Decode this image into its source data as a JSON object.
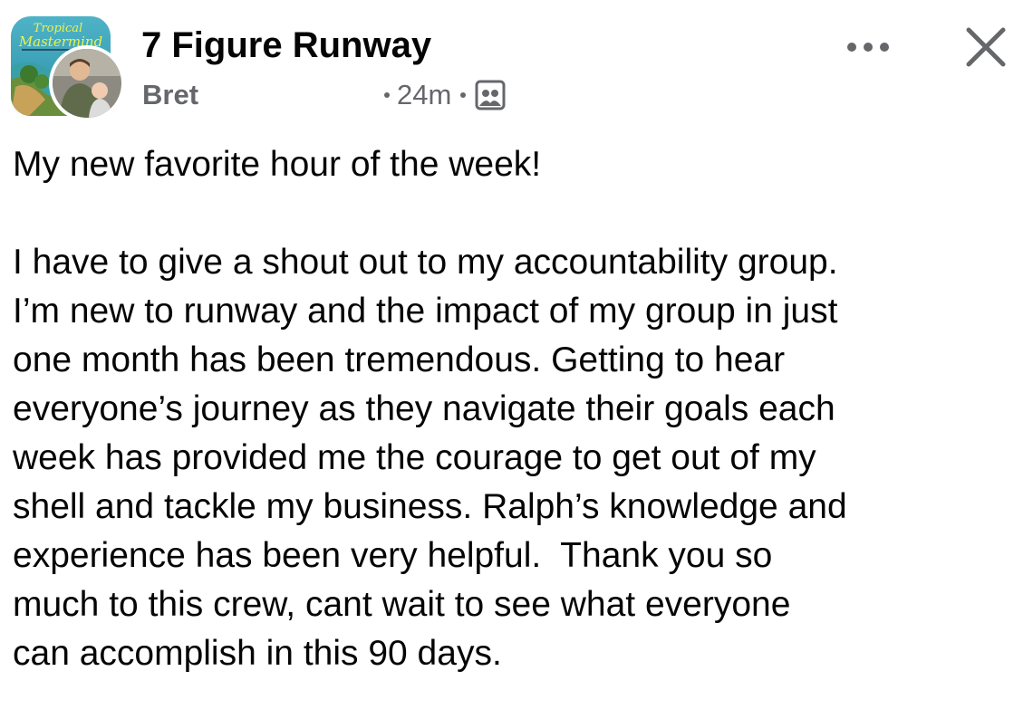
{
  "post": {
    "group_name": "7 Figure Runway",
    "group_avatar_text": "Tropical Mastermind",
    "author": "Bret",
    "time": "24m",
    "body": {
      "headline": "My new favorite hour of the week!",
      "lines": [
        "I have to give a shout out to my accountability group.",
        "I’m new to runway and the impact of my group in just",
        "one month has been tremendous. Getting to hear",
        "everyone’s journey as they navigate their goals each",
        "week has provided me the courage to get out of my",
        "shell and tackle my business. Ralph’s knowledge and",
        "experience has been very helpful.  Thank you so",
        "much to this crew, cant wait to see what everyone",
        "can accomplish in this 90 days."
      ]
    }
  },
  "icons": {
    "more": "more-horizontal-icon",
    "close": "close-icon",
    "audience": "group-members-icon"
  },
  "colors": {
    "text": "#050505",
    "secondary": "#65676b",
    "background": "#ffffff"
  }
}
